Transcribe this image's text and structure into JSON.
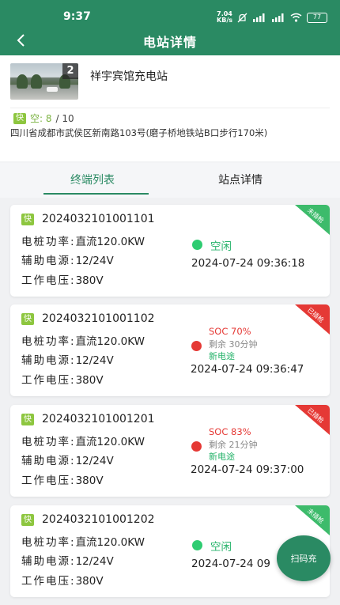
{
  "status_bar": {
    "time": "9:37",
    "net_speed_value": "7.04",
    "net_speed_unit": "KB/s",
    "battery": "77"
  },
  "nav": {
    "back_icon": "chevron-left-icon",
    "title": "电站详情"
  },
  "station": {
    "name": "祥宇宾馆充电站",
    "photo_count": "2",
    "fast_tag": "快",
    "free_label": "空: 8",
    "total_label": "/ 10",
    "address": "四川省成都市武侯区新南路103号(磨子桥地铁站B口步行170米)"
  },
  "tabs": [
    {
      "label": "终端列表",
      "active": true
    },
    {
      "label": "站点详情",
      "active": false
    }
  ],
  "spec_labels": {
    "power": "电桩功率:",
    "aux": "辅助电源:",
    "voltage": "工作电压:"
  },
  "terminals": [
    {
      "fast_tag": "快",
      "id": "2024032101001101",
      "power": "直流120.0KW",
      "aux_power": "12/24V",
      "voltage": "380V",
      "status": "空闲",
      "time": "2024-07-24 09:36:18",
      "corner_label": "未插枪",
      "corner_color": "#3dbb6b"
    },
    {
      "fast_tag": "快",
      "id": "2024032101001102",
      "power": "直流120.0KW",
      "aux_power": "12/24V",
      "voltage": "380V",
      "soc": "SOC 70%",
      "remaining": "剩余 30分钟",
      "vehicle": "新电途",
      "time": "2024-07-24 09:36:47",
      "corner_label": "已插枪",
      "corner_color": "#e53935"
    },
    {
      "fast_tag": "快",
      "id": "2024032101001201",
      "power": "直流120.0KW",
      "aux_power": "12/24V",
      "voltage": "380V",
      "soc": "SOC 83%",
      "remaining": "剩余 21分钟",
      "vehicle": "新电途",
      "time": "2024-07-24 09:37:00",
      "corner_label": "已插枪",
      "corner_color": "#e53935"
    },
    {
      "fast_tag": "快",
      "id": "2024032101001202",
      "power": "直流120.0KW",
      "aux_power": "12/24V",
      "voltage": "380V",
      "status": "空闲",
      "time": "2024-07-24 09",
      "corner_label": "未插枪",
      "corner_color": "#3dbb6b"
    }
  ],
  "scan_button": {
    "label": "扫码充"
  },
  "colors": {
    "brand": "#2a8a63",
    "fast_tag": "#8dc63f",
    "idle": "#2ecc71",
    "charging": "#e53935"
  }
}
